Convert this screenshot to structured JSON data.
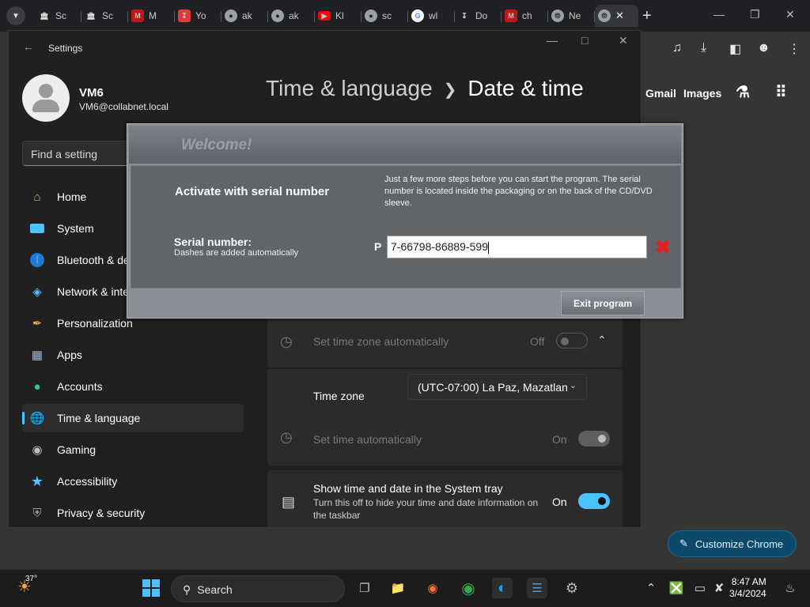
{
  "browser": {
    "tabs": [
      {
        "label": "Sc",
        "icon": "bank-icon"
      },
      {
        "label": "Sc",
        "icon": "bank-icon"
      },
      {
        "label": "M",
        "icon": "mcafee-icon"
      },
      {
        "label": "Yo",
        "icon": "download-app-icon"
      },
      {
        "label": "ak",
        "icon": "globe-icon"
      },
      {
        "label": "ak",
        "icon": "globe-icon"
      },
      {
        "label": "Kl",
        "icon": "youtube-icon"
      },
      {
        "label": "sc",
        "icon": "globe-icon"
      },
      {
        "label": "wl",
        "icon": "google-icon"
      },
      {
        "label": "Do",
        "icon": "downloads-icon"
      },
      {
        "label": "ch",
        "icon": "mcafee-icon"
      },
      {
        "label": "Ne",
        "icon": "chrome-icon"
      }
    ],
    "new_tab": "+",
    "links": {
      "gmail": "Gmail",
      "images": "Images"
    },
    "customize_label": "Customize Chrome"
  },
  "settings": {
    "title": "Settings",
    "user": {
      "name": "VM6",
      "email": "VM6@collabnet.local"
    },
    "search_placeholder": "Find a setting",
    "nav": [
      {
        "label": "Home",
        "icon": "home-icon"
      },
      {
        "label": "System",
        "icon": "system-icon"
      },
      {
        "label": "Bluetooth & devices",
        "icon": "bluetooth-icon"
      },
      {
        "label": "Network & internet",
        "icon": "wifi-icon"
      },
      {
        "label": "Personalization",
        "icon": "brush-icon"
      },
      {
        "label": "Apps",
        "icon": "apps-icon"
      },
      {
        "label": "Accounts",
        "icon": "accounts-icon"
      },
      {
        "label": "Time & language",
        "icon": "globe-clock-icon"
      },
      {
        "label": "Gaming",
        "icon": "gamepad-icon"
      },
      {
        "label": "Accessibility",
        "icon": "accessibility-icon"
      },
      {
        "label": "Privacy & security",
        "icon": "shield-icon"
      }
    ],
    "breadcrumb": {
      "parent": "Time & language",
      "current": "Date & time"
    },
    "tz_auto": {
      "label": "Set time zone automatically",
      "state": "Off"
    },
    "timezone": {
      "label": "Time zone",
      "value": "(UTC-07:00) La Paz, Mazatlan"
    },
    "time_auto": {
      "label": "Set time automatically",
      "state": "On"
    },
    "tray": {
      "label": "Show time and date in the System tray",
      "sub": "Turn this off to hide your time and date information on the taskbar",
      "state": "On"
    }
  },
  "dialog": {
    "title": "Welcome!",
    "activate": "Activate with serial number",
    "info": "Just a few more steps before you can start the program. The serial number is located inside the packaging or on the back of the CD/DVD sleeve.",
    "serial_label": "Serial number:",
    "serial_note": "Dashes are added automatically",
    "serial_prefix": "P",
    "serial_value": "7-66798-86889-599",
    "exit_label": "Exit program"
  },
  "taskbar": {
    "weather": "37°",
    "search": "Search",
    "time": "8:47 AM",
    "date": "3/4/2024"
  }
}
